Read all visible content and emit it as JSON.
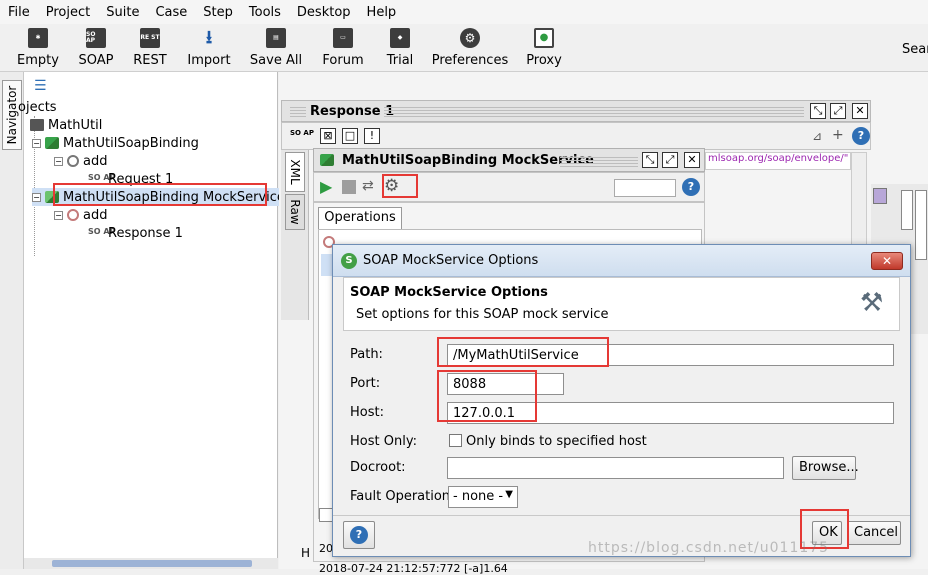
{
  "menu": [
    "File",
    "Project",
    "Suite",
    "Case",
    "Step",
    "Tools",
    "Desktop",
    "Help"
  ],
  "toolbar": {
    "items": [
      {
        "label": "Empty",
        "icon": "new-empty-project-icon"
      },
      {
        "label": "SOAP",
        "icon": "soap-icon",
        "glyph": "SO AP"
      },
      {
        "label": "REST",
        "icon": "rest-icon",
        "glyph": "RE ST"
      },
      {
        "label": "Import",
        "icon": "import-icon"
      },
      {
        "label": "Save All",
        "icon": "save-all-icon"
      },
      {
        "label": "Forum",
        "icon": "forum-icon"
      },
      {
        "label": "Trial",
        "icon": "trial-icon"
      },
      {
        "label": "Preferences",
        "icon": "gear-icon"
      },
      {
        "label": "Proxy",
        "icon": "proxy-icon"
      }
    ],
    "search_label": "Sear"
  },
  "navigator": {
    "tab_label": "Navigator"
  },
  "tree": {
    "root_label": "ojects",
    "project": "MathUtil",
    "binding": "MathUtilSoapBinding",
    "operation": "add",
    "request": "Request 1",
    "mock_service": "MathUtilSoapBinding MockService",
    "mock_operation": "add",
    "mock_response": "Response 1"
  },
  "response_panel": {
    "title": "Response 1",
    "side_tabs": [
      "XML",
      "Raw"
    ],
    "url_fragment": "mlsoap.org/soap/envelope/\" x",
    "log_prefix": "H",
    "log_line1": "20",
    "log_line2": "2018-07-24 21:12:57:772 [-a]1.64"
  },
  "mock_panel": {
    "title": "MathUtilSoapBinding MockService",
    "tab": "Operations"
  },
  "dialog": {
    "title": "SOAP MockService Options",
    "heading": "SOAP MockService Options",
    "description": "Set options for this SOAP mock service",
    "labels": {
      "path": "Path:",
      "port": "Port:",
      "host": "Host:",
      "host_only": "Host Only:",
      "docroot": "Docroot:",
      "fault_operation": "Fault Operation:"
    },
    "values": {
      "path": "/MyMathUtilService",
      "port": "8088",
      "host": "127.0.0.1",
      "docroot": "",
      "fault_operation": "- none -"
    },
    "host_only_checkbox": "Only binds to specified host",
    "browse_button": "Browse...",
    "ok_button": "OK",
    "cancel_button": "Cancel"
  },
  "watermark": "https://blog.csdn.net/u011175"
}
